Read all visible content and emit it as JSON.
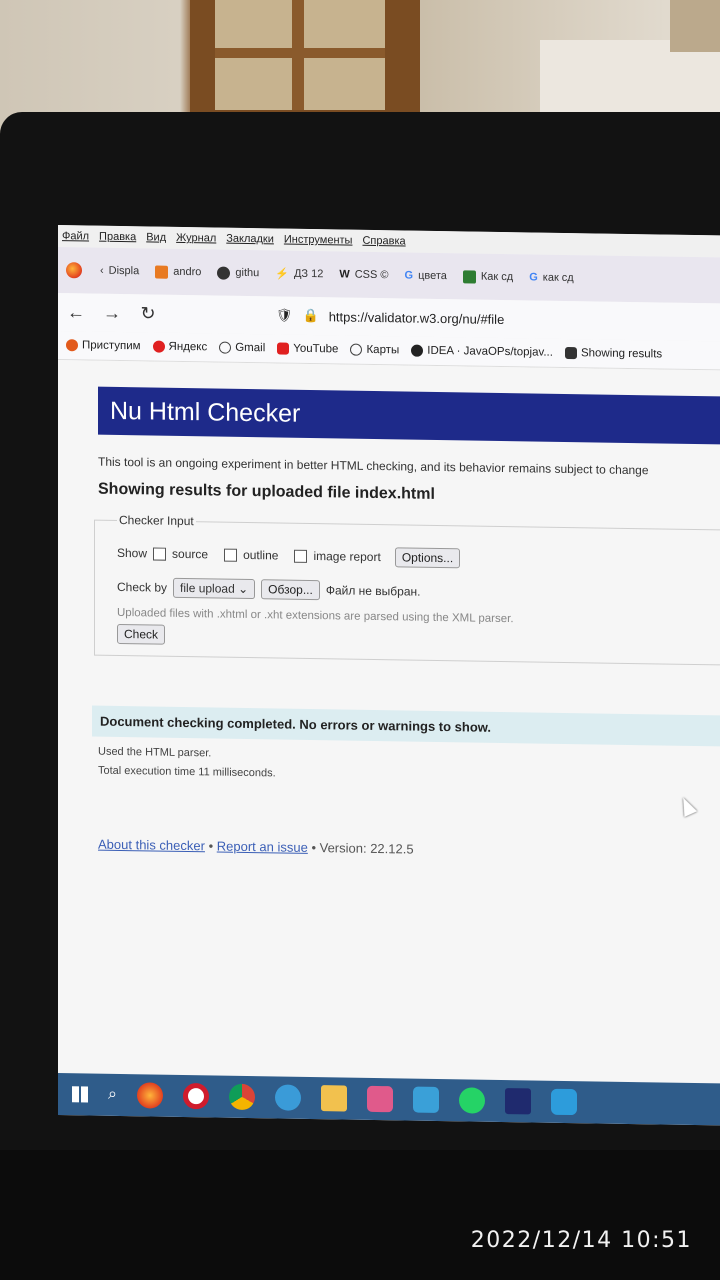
{
  "menu": [
    "Файл",
    "Правка",
    "Вид",
    "Журнал",
    "Закладки",
    "Инструменты",
    "Справка"
  ],
  "tabs": [
    {
      "label": "Displa",
      "icon": "chevron-left-icon"
    },
    {
      "label": "andro",
      "icon": "stackoverflow-icon"
    },
    {
      "label": "githu",
      "icon": "github-icon"
    },
    {
      "label": "ДЗ 12",
      "icon": "bolt-icon"
    },
    {
      "label": "CSS ©",
      "icon": "w3schools-icon"
    },
    {
      "label": "цвета",
      "icon": "google-icon"
    },
    {
      "label": "Как сд",
      "icon": "site-icon"
    },
    {
      "label": "как сд",
      "icon": "google-icon"
    }
  ],
  "url": "https://validator.w3.org/nu/#file",
  "bookmarks": [
    {
      "label": "Приступим",
      "color": "#e25a1c"
    },
    {
      "label": "Яндекс",
      "color": "#e02020"
    },
    {
      "label": "Gmail",
      "color": "#444444"
    },
    {
      "label": "YouTube",
      "color": "#e02020"
    },
    {
      "label": "Карты",
      "color": "#444444"
    },
    {
      "label": "IDEA · JavaOPs/topjav...",
      "color": "#222222"
    },
    {
      "label": "Showing results",
      "color": "#333333"
    }
  ],
  "page": {
    "title": "Nu Html Checker",
    "intro": "This tool is an ongoing experiment in better HTML checking, and its behavior remains subject to change",
    "showing": "Showing results for uploaded file index.html",
    "legend": "Checker Input",
    "show_label": "Show",
    "opt_source": "source",
    "opt_outline": "outline",
    "opt_image": "image report",
    "options_btn": "Options...",
    "checkby_label": "Check by",
    "checkby_value": "file upload",
    "browse_btn": "Обзор...",
    "no_file": "Файл не выбран.",
    "note": "Uploaded files with .xhtml or .xht extensions are parsed using the XML parser.",
    "check_btn": "Check",
    "success": "Document checking completed. No errors or warnings to show.",
    "parser": "Used the HTML parser.",
    "exec_time": "Total execution time 11 milliseconds.",
    "about_link": "About this checker",
    "report_link": "Report an issue",
    "version": "Version: 22.12.5"
  },
  "timestamp": "2022/12/14  10:51",
  "colors": {
    "hero": "#1e2a8a",
    "success_bg": "#dcedf1",
    "link": "#3b5fb6"
  }
}
